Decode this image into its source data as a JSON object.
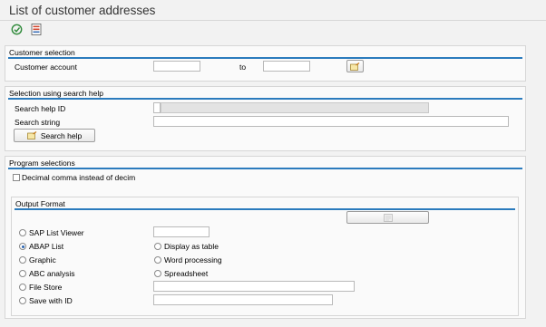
{
  "title": "List of customer addresses",
  "toolbar": {
    "execute_icon": "execute-icon",
    "variant_icon": "variant-list-icon"
  },
  "customer_selection": {
    "title": "Customer selection",
    "customer_account_label": "Customer account",
    "customer_account_from": "",
    "to_label": "to",
    "customer_account_to": ""
  },
  "search_help": {
    "title": "Selection using search help",
    "search_help_id_label": "Search help ID",
    "search_help_id_value": "",
    "search_string_label": "Search string",
    "search_string_value": "",
    "button_label": "Search help"
  },
  "program_selections": {
    "title": "Program selections",
    "decimal_comma_label": "Decimal comma instead of decim",
    "decimal_comma_checked": false
  },
  "output_format": {
    "title": "Output Format",
    "sap_list_viewer_label": "SAP List Viewer",
    "sap_list_viewer_value": "",
    "abap_list_label": "ABAP List",
    "display_as_table_label": "Display as table",
    "graphic_label": "Graphic",
    "word_processing_label": "Word processing",
    "abc_analysis_label": "ABC analysis",
    "spreadsheet_label": "Spreadsheet",
    "file_store_label": "File Store",
    "file_store_value": "",
    "save_with_id_label": "Save with ID",
    "save_with_id_value": "",
    "selected": "ABAP List"
  }
}
